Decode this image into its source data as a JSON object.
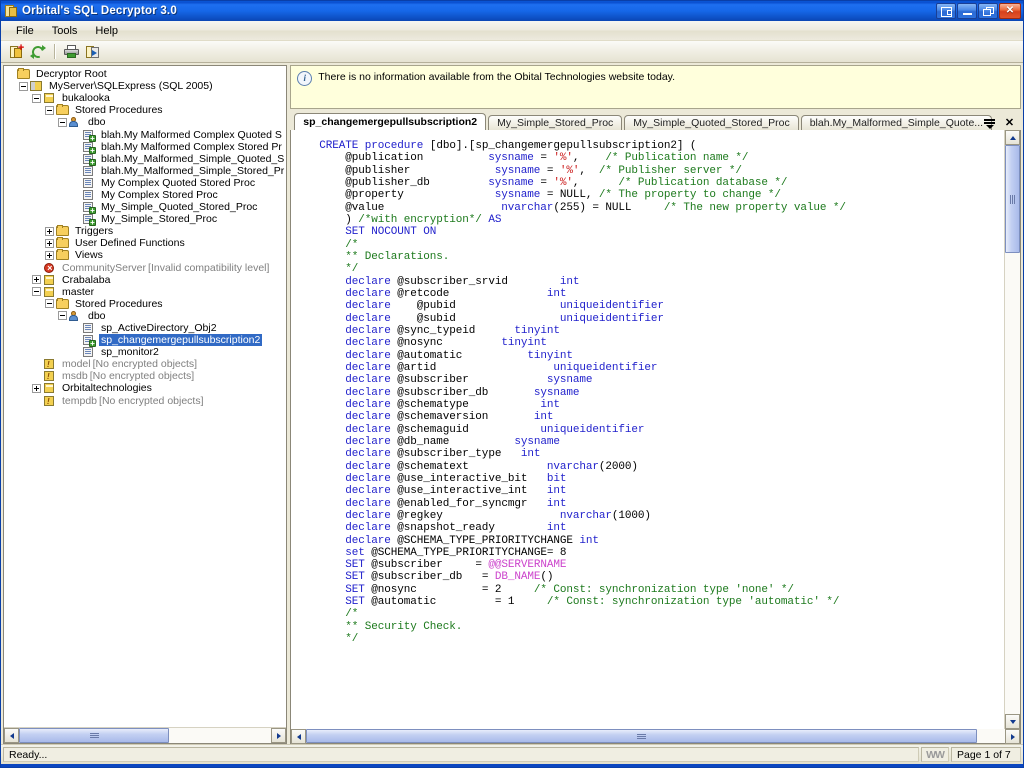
{
  "window": {
    "title": "Orbital's SQL Decryptor 3.0",
    "app_icon": "app-document-icon",
    "buttons": [
      {
        "name": "mdi-restore-button",
        "glyph": "mdi"
      },
      {
        "name": "minimize-button",
        "glyph": "minimize"
      },
      {
        "name": "maximize-button",
        "glyph": "maximize"
      },
      {
        "name": "close-button",
        "glyph": "close"
      }
    ]
  },
  "menu": {
    "items": [
      {
        "label": "File"
      },
      {
        "label": "Tools"
      },
      {
        "label": "Help"
      }
    ]
  },
  "toolbar": {
    "buttons": [
      {
        "name": "new-decryption-button",
        "icon": "new-document-icon",
        "title": "New"
      },
      {
        "name": "refresh-button",
        "icon": "refresh-icon",
        "title": "Refresh"
      },
      {
        "name": "print-button",
        "icon": "print-icon",
        "title": "Print"
      },
      {
        "name": "export-button",
        "icon": "export-icon",
        "title": "Export"
      }
    ]
  },
  "infobar": {
    "icon": "info-icon",
    "message": "There is no information available from the Obital Technologies website today."
  },
  "tree": {
    "nodes": [
      {
        "indent": 0,
        "toggle": "none",
        "icon": "folder-open-icon",
        "label": "Decryptor Root",
        "suffix": "",
        "state": "normal"
      },
      {
        "indent": 1,
        "toggle": "minus",
        "icon": "server-icon",
        "label": "MyServer\\SQLExpress (SQL 2005)",
        "suffix": "",
        "state": "normal"
      },
      {
        "indent": 2,
        "toggle": "minus",
        "icon": "database-icon",
        "label": "bukalooka",
        "suffix": "",
        "state": "normal"
      },
      {
        "indent": 3,
        "toggle": "minus",
        "icon": "folder-open-icon",
        "label": "Stored Procedures",
        "suffix": "",
        "state": "normal"
      },
      {
        "indent": 4,
        "toggle": "minus",
        "icon": "user-schema-icon",
        "label": "dbo",
        "suffix": "",
        "state": "normal"
      },
      {
        "indent": 5,
        "toggle": "none",
        "icon": "procedure-decrypted-icon",
        "label": "blah.My Malformed Complex Quoted S",
        "suffix": "",
        "state": "normal"
      },
      {
        "indent": 5,
        "toggle": "none",
        "icon": "procedure-decrypted-icon",
        "label": "blah.My Malformed Complex Stored Pr",
        "suffix": "",
        "state": "normal"
      },
      {
        "indent": 5,
        "toggle": "none",
        "icon": "procedure-decrypted-icon",
        "label": "blah.My_Malformed_Simple_Quoted_S",
        "suffix": "",
        "state": "normal"
      },
      {
        "indent": 5,
        "toggle": "none",
        "icon": "procedure-icon",
        "label": "blah.My_Malformed_Simple_Stored_Pr",
        "suffix": "",
        "state": "normal"
      },
      {
        "indent": 5,
        "toggle": "none",
        "icon": "procedure-icon",
        "label": "My Complex Quoted Stored Proc",
        "suffix": "",
        "state": "normal"
      },
      {
        "indent": 5,
        "toggle": "none",
        "icon": "procedure-icon",
        "label": "My Complex Stored Proc",
        "suffix": "",
        "state": "normal"
      },
      {
        "indent": 5,
        "toggle": "none",
        "icon": "procedure-decrypted-icon",
        "label": "My_Simple_Quoted_Stored_Proc",
        "suffix": "",
        "state": "normal"
      },
      {
        "indent": 5,
        "toggle": "none",
        "icon": "procedure-decrypted-icon",
        "label": "My_Simple_Stored_Proc",
        "suffix": "",
        "state": "normal"
      },
      {
        "indent": 3,
        "toggle": "plus",
        "icon": "folder-icon",
        "label": "Triggers",
        "suffix": "",
        "state": "normal"
      },
      {
        "indent": 3,
        "toggle": "plus",
        "icon": "folder-icon",
        "label": "User Defined Functions",
        "suffix": "",
        "state": "normal"
      },
      {
        "indent": 3,
        "toggle": "plus",
        "icon": "folder-icon",
        "label": "Views",
        "suffix": "",
        "state": "normal"
      },
      {
        "indent": 2,
        "toggle": "none",
        "icon": "database-error-icon",
        "label": "CommunityServer",
        "suffix": "[Invalid compatibility level]",
        "state": "dim"
      },
      {
        "indent": 2,
        "toggle": "plus",
        "icon": "database-icon",
        "label": "Crabalaba",
        "suffix": "",
        "state": "normal"
      },
      {
        "indent": 2,
        "toggle": "minus",
        "icon": "database-icon",
        "label": "master",
        "suffix": "",
        "state": "normal"
      },
      {
        "indent": 3,
        "toggle": "minus",
        "icon": "folder-open-icon",
        "label": "Stored Procedures",
        "suffix": "",
        "state": "normal"
      },
      {
        "indent": 4,
        "toggle": "minus",
        "icon": "user-schema-icon",
        "label": "dbo",
        "suffix": "",
        "state": "normal"
      },
      {
        "indent": 5,
        "toggle": "none",
        "icon": "procedure-icon",
        "label": "sp_ActiveDirectory_Obj2",
        "suffix": "",
        "state": "normal"
      },
      {
        "indent": 5,
        "toggle": "none",
        "icon": "procedure-decrypted-icon",
        "label": "sp_changemergepullsubscription2",
        "suffix": "",
        "state": "selected"
      },
      {
        "indent": 5,
        "toggle": "none",
        "icon": "procedure-icon",
        "label": "sp_monitor2",
        "suffix": "",
        "state": "normal"
      },
      {
        "indent": 2,
        "toggle": "none",
        "icon": "database-warn-icon",
        "label": "model",
        "suffix": "[No encrypted objects]",
        "state": "dim"
      },
      {
        "indent": 2,
        "toggle": "none",
        "icon": "database-warn-icon",
        "label": "msdb",
        "suffix": "[No encrypted objects]",
        "state": "dim"
      },
      {
        "indent": 2,
        "toggle": "plus",
        "icon": "database-icon",
        "label": "Orbitaltechnologies",
        "suffix": "",
        "state": "normal"
      },
      {
        "indent": 2,
        "toggle": "none",
        "icon": "database-warn-icon",
        "label": "tempdb",
        "suffix": "[No encrypted objects]",
        "state": "dim"
      }
    ]
  },
  "tabs": {
    "items": [
      {
        "label": "sp_changemergepullsubscription2",
        "active": true
      },
      {
        "label": "My_Simple_Stored_Proc",
        "active": false
      },
      {
        "label": "My_Simple_Quoted_Stored_Proc",
        "active": false
      },
      {
        "label": "blah.My_Malformed_Simple_Quote...",
        "active": false
      }
    ],
    "tools": [
      {
        "name": "tab-list-dropdown",
        "icon": "chevron-down-list-icon"
      },
      {
        "name": "tab-close-button",
        "icon": "close-icon",
        "glyph": "✕"
      }
    ]
  },
  "editor": {
    "lines": [
      [
        [
          "k",
          "CREATE"
        ],
        [
          "n",
          " "
        ],
        [
          "k",
          "procedure"
        ],
        [
          "n",
          " [dbo].[sp_changemergepullsubscription2] ("
        ]
      ],
      [
        [
          "n",
          "    @publication          "
        ],
        [
          "kb",
          "sysname"
        ],
        [
          "n",
          " = "
        ],
        [
          "s",
          "'%'"
        ],
        [
          "n",
          ",    "
        ],
        [
          "c",
          "/* Publication name */"
        ]
      ],
      [
        [
          "n",
          "    @publisher             "
        ],
        [
          "kb",
          "sysname"
        ],
        [
          "n",
          " = "
        ],
        [
          "s",
          "'%'"
        ],
        [
          "n",
          ",  "
        ],
        [
          "c",
          "/* Publisher server */"
        ]
      ],
      [
        [
          "n",
          "    @publisher_db         "
        ],
        [
          "kb",
          "sysname"
        ],
        [
          "n",
          " = "
        ],
        [
          "s",
          "'%'"
        ],
        [
          "n",
          ",      "
        ],
        [
          "c",
          "/* Publication database */"
        ]
      ],
      [
        [
          "n",
          "    @property              "
        ],
        [
          "kb",
          "sysname"
        ],
        [
          "n",
          " = NULL, "
        ],
        [
          "c",
          "/* The property to change */"
        ]
      ],
      [
        [
          "n",
          "    @value                  "
        ],
        [
          "kb",
          "nvarchar"
        ],
        [
          "n",
          "(255) = NULL     "
        ],
        [
          "c",
          "/* The new property value */"
        ]
      ],
      [
        [
          "n",
          "    ) "
        ],
        [
          "c",
          "/*with encryption*/"
        ],
        [
          "n",
          " "
        ],
        [
          "k",
          "AS"
        ]
      ],
      [
        [
          "n",
          ""
        ]
      ],
      [
        [
          "n",
          "    "
        ],
        [
          "k",
          "SET NOCOUNT ON"
        ]
      ],
      [
        [
          "n",
          ""
        ]
      ],
      [
        [
          "n",
          "    "
        ],
        [
          "c",
          "/*"
        ]
      ],
      [
        [
          "n",
          "    "
        ],
        [
          "c",
          "** Declarations."
        ]
      ],
      [
        [
          "n",
          "    "
        ],
        [
          "c",
          "*/"
        ]
      ],
      [
        [
          "n",
          "    "
        ],
        [
          "k",
          "declare"
        ],
        [
          "n",
          " @subscriber_srvid        "
        ],
        [
          "kb",
          "int"
        ]
      ],
      [
        [
          "n",
          "    "
        ],
        [
          "k",
          "declare"
        ],
        [
          "n",
          " @retcode               "
        ],
        [
          "kb",
          "int"
        ]
      ],
      [
        [
          "n",
          "    "
        ],
        [
          "k",
          "declare"
        ],
        [
          "n",
          "    @pubid                "
        ],
        [
          "kb",
          "uniqueidentifier"
        ]
      ],
      [
        [
          "n",
          "    "
        ],
        [
          "k",
          "declare"
        ],
        [
          "n",
          "    @subid                "
        ],
        [
          "kb",
          "uniqueidentifier"
        ]
      ],
      [
        [
          "n",
          "    "
        ],
        [
          "k",
          "declare"
        ],
        [
          "n",
          " @sync_typeid      "
        ],
        [
          "kb",
          "tinyint"
        ]
      ],
      [
        [
          "n",
          "    "
        ],
        [
          "k",
          "declare"
        ],
        [
          "n",
          " @nosync         "
        ],
        [
          "kb",
          "tinyint"
        ]
      ],
      [
        [
          "n",
          "    "
        ],
        [
          "k",
          "declare"
        ],
        [
          "n",
          " @automatic          "
        ],
        [
          "kb",
          "tinyint"
        ]
      ],
      [
        [
          "n",
          ""
        ]
      ],
      [
        [
          "n",
          "    "
        ],
        [
          "k",
          "declare"
        ],
        [
          "n",
          " @artid                  "
        ],
        [
          "kb",
          "uniqueidentifier"
        ]
      ],
      [
        [
          "n",
          "    "
        ],
        [
          "k",
          "declare"
        ],
        [
          "n",
          " @subscriber            "
        ],
        [
          "kb",
          "sysname"
        ]
      ],
      [
        [
          "n",
          "    "
        ],
        [
          "k",
          "declare"
        ],
        [
          "n",
          " @subscriber_db       "
        ],
        [
          "kb",
          "sysname"
        ]
      ],
      [
        [
          "n",
          "    "
        ],
        [
          "k",
          "declare"
        ],
        [
          "n",
          " @schematype           "
        ],
        [
          "kb",
          "int"
        ]
      ],
      [
        [
          "n",
          "    "
        ],
        [
          "k",
          "declare"
        ],
        [
          "n",
          " @schemaversion       "
        ],
        [
          "kb",
          "int"
        ]
      ],
      [
        [
          "n",
          "    "
        ],
        [
          "k",
          "declare"
        ],
        [
          "n",
          " @schemaguid           "
        ],
        [
          "kb",
          "uniqueidentifier"
        ]
      ],
      [
        [
          "n",
          "    "
        ],
        [
          "k",
          "declare"
        ],
        [
          "n",
          " @db_name          "
        ],
        [
          "kb",
          "sysname"
        ]
      ],
      [
        [
          "n",
          "    "
        ],
        [
          "k",
          "declare"
        ],
        [
          "n",
          " @subscriber_type   "
        ],
        [
          "kb",
          "int"
        ]
      ],
      [
        [
          "n",
          "    "
        ],
        [
          "k",
          "declare"
        ],
        [
          "n",
          " @schematext            "
        ],
        [
          "kb",
          "nvarchar"
        ],
        [
          "n",
          "(2000)"
        ]
      ],
      [
        [
          "n",
          "    "
        ],
        [
          "k",
          "declare"
        ],
        [
          "n",
          " @use_interactive_bit   "
        ],
        [
          "kb",
          "bit"
        ]
      ],
      [
        [
          "n",
          "    "
        ],
        [
          "k",
          "declare"
        ],
        [
          "n",
          " @use_interactive_int   "
        ],
        [
          "kb",
          "int"
        ]
      ],
      [
        [
          "n",
          "    "
        ],
        [
          "k",
          "declare"
        ],
        [
          "n",
          " @enabled_for_syncmgr   "
        ],
        [
          "kb",
          "int"
        ]
      ],
      [
        [
          "n",
          "    "
        ],
        [
          "k",
          "declare"
        ],
        [
          "n",
          " @regkey                  "
        ],
        [
          "kb",
          "nvarchar"
        ],
        [
          "n",
          "(1000)"
        ]
      ],
      [
        [
          "n",
          "    "
        ],
        [
          "k",
          "declare"
        ],
        [
          "n",
          " @snapshot_ready        "
        ],
        [
          "kb",
          "int"
        ]
      ],
      [
        [
          "n",
          "    "
        ],
        [
          "k",
          "declare"
        ],
        [
          "n",
          " @SCHEMA_TYPE_PRIORITYCHANGE "
        ],
        [
          "kb",
          "int"
        ]
      ],
      [
        [
          "n",
          ""
        ]
      ],
      [
        [
          "n",
          "    "
        ],
        [
          "k",
          "set"
        ],
        [
          "n",
          " @SCHEMA_TYPE_PRIORITYCHANGE= 8"
        ]
      ],
      [
        [
          "n",
          "    "
        ],
        [
          "k",
          "SET"
        ],
        [
          "n",
          " @subscriber     = "
        ],
        [
          "f",
          "@@SERVERNAME"
        ]
      ],
      [
        [
          "n",
          "    "
        ],
        [
          "k",
          "SET"
        ],
        [
          "n",
          " @subscriber_db   = "
        ],
        [
          "f",
          "DB_NAME"
        ],
        [
          "n",
          "()"
        ]
      ],
      [
        [
          "n",
          "    "
        ],
        [
          "k",
          "SET"
        ],
        [
          "n",
          " @nosync          = 2     "
        ],
        [
          "c",
          "/* Const: synchronization type 'none' */"
        ]
      ],
      [
        [
          "n",
          "    "
        ],
        [
          "k",
          "SET"
        ],
        [
          "n",
          " @automatic         = 1     "
        ],
        [
          "c",
          "/* Const: synchronization type 'automatic' */"
        ]
      ],
      [
        [
          "n",
          ""
        ]
      ],
      [
        [
          "n",
          "    "
        ],
        [
          "c",
          "/*"
        ]
      ],
      [
        [
          "n",
          "    "
        ],
        [
          "c",
          "** Security Check."
        ]
      ],
      [
        [
          "n",
          "    "
        ],
        [
          "c",
          "*/"
        ]
      ]
    ]
  },
  "statusbar": {
    "message": "Ready...",
    "ww_indicator": "WW",
    "page_indicator": "Page 1 of 7"
  },
  "colors": {
    "titlebar_blue": "#1667e8",
    "keyword": "#2222cc",
    "comment": "#1d7a1d",
    "string": "#cc2222",
    "function": "#cc44cc",
    "selection": "#316ac5",
    "infobar_bg": "#ffffdc"
  }
}
